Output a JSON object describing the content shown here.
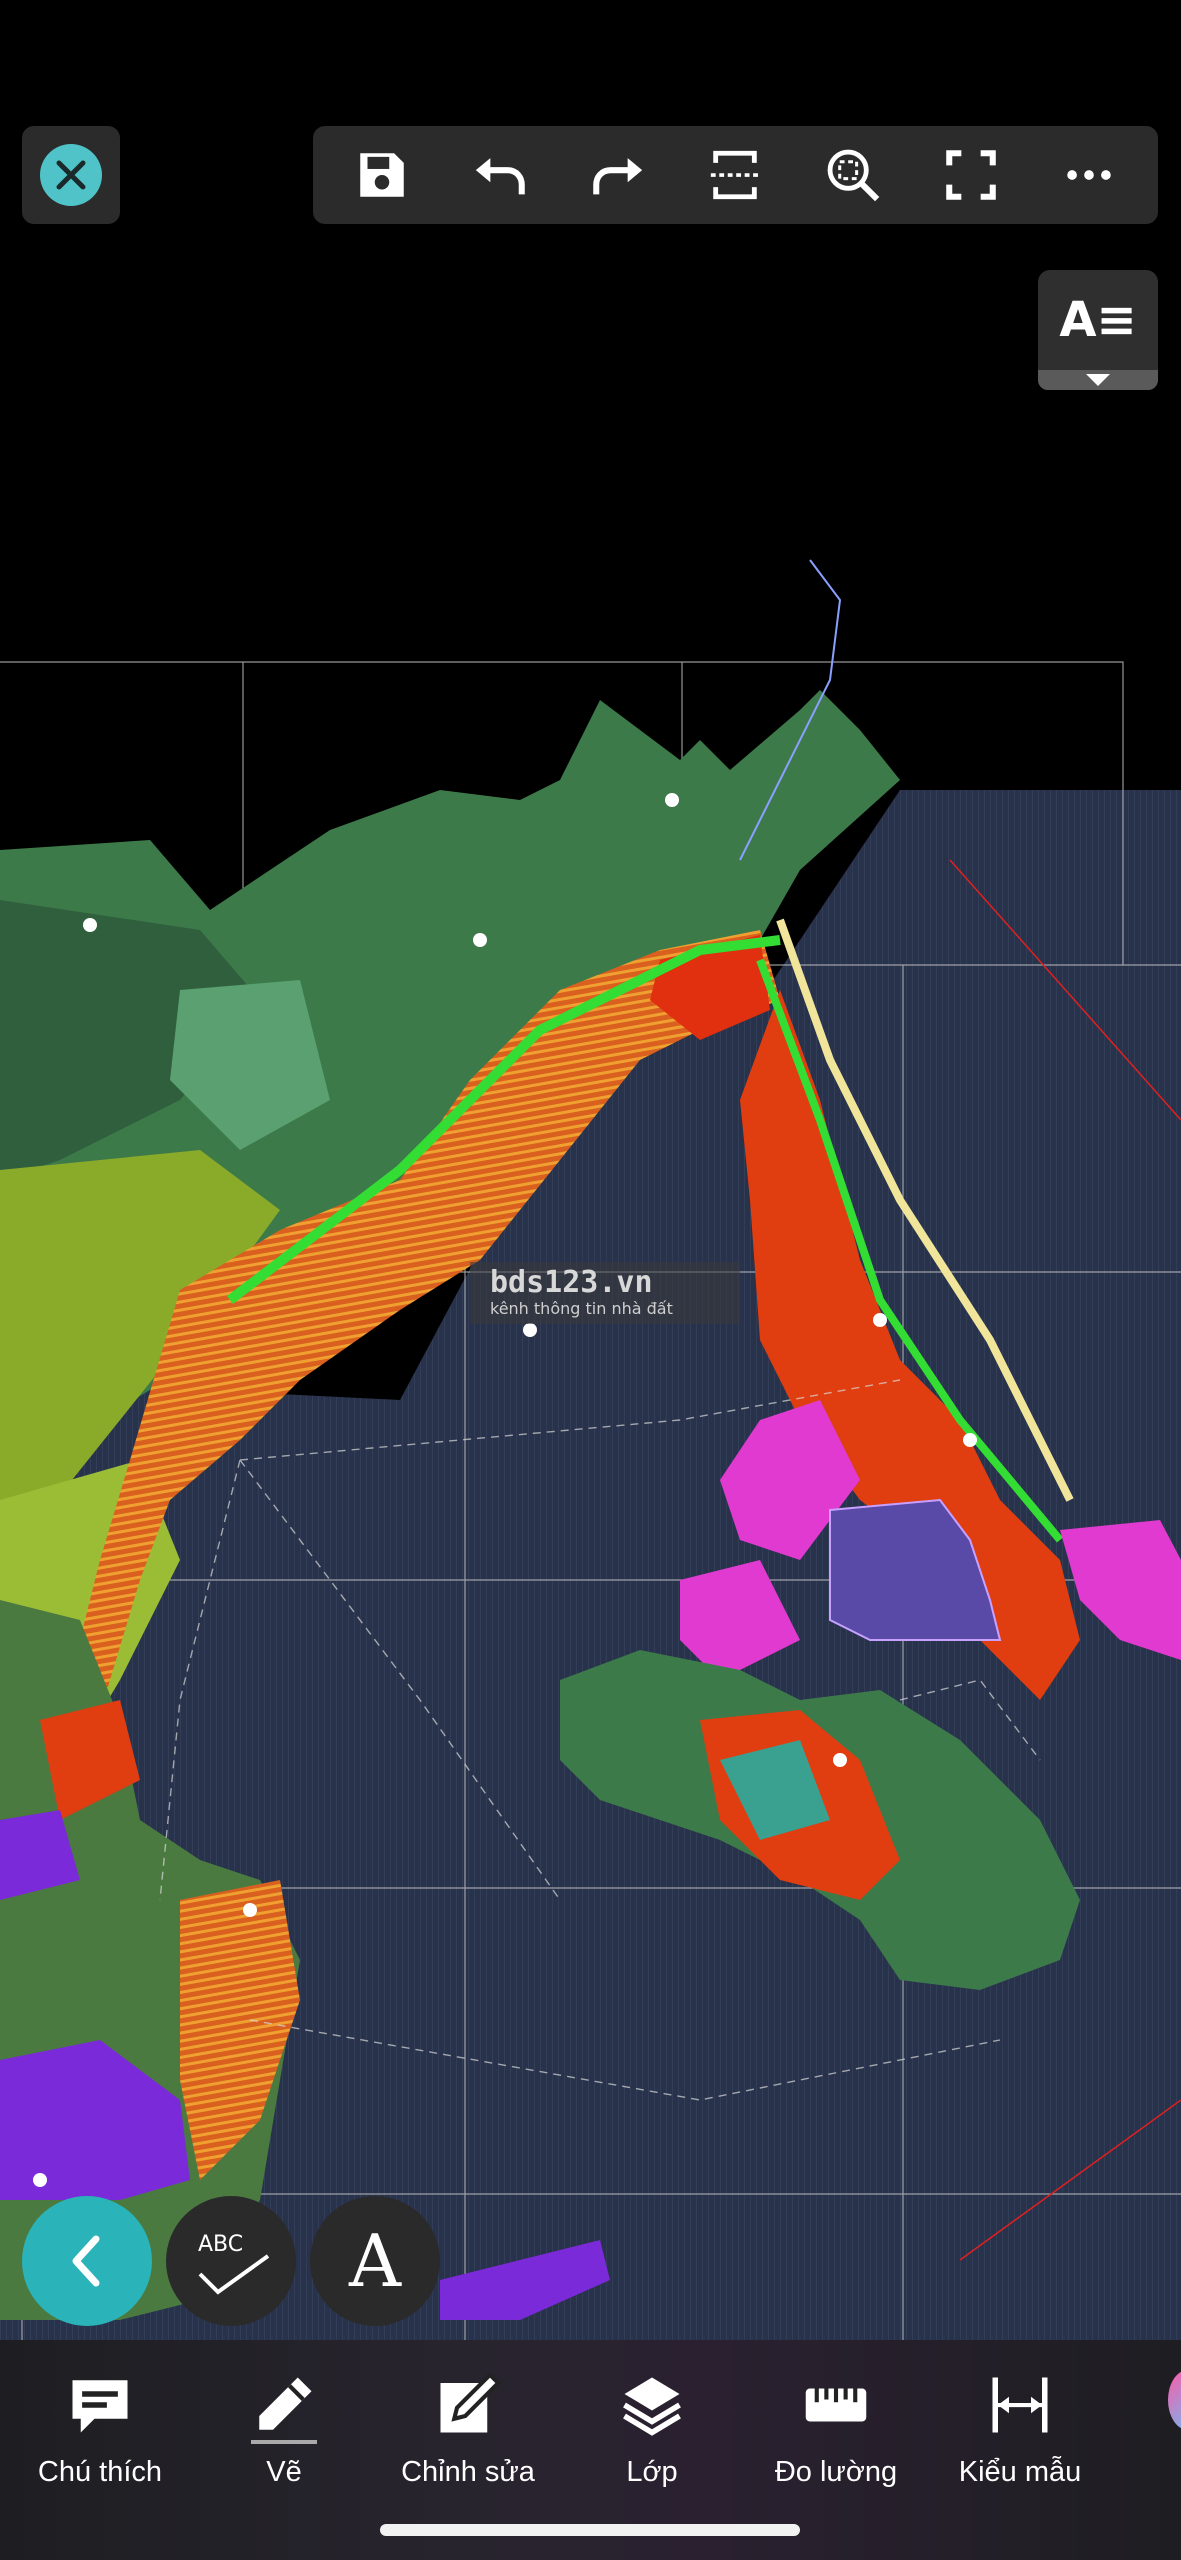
{
  "toolbar": {
    "close": "close-icon",
    "buttons": [
      "save-icon",
      "undo-icon",
      "redo-icon",
      "fit-width-icon",
      "zoom-region-icon",
      "fullscreen-icon",
      "more-icon"
    ]
  },
  "layers_button": {
    "label": "A≡"
  },
  "drawing": {
    "watermark_title": "bds123.vn",
    "watermark_subtitle": "kênh thông tin nhà đất"
  },
  "fabs": {
    "back": "chevron-left-icon",
    "spellcheck": {
      "label": "ABC"
    },
    "text": {
      "label": "A"
    }
  },
  "bottom_nav": {
    "items": [
      {
        "label": "Chú thích",
        "icon": "comment-icon"
      },
      {
        "label": "Vẽ",
        "icon": "pencil-icon"
      },
      {
        "label": "Chỉnh sửa",
        "icon": "edit-icon"
      },
      {
        "label": "Lớp",
        "icon": "layers-icon"
      },
      {
        "label": "Đo lường",
        "icon": "ruler-icon"
      },
      {
        "label": "Kiểu mẫu",
        "icon": "dimension-icon"
      }
    ]
  },
  "colors": {
    "accent": "#2ab3b8",
    "background": "#000000",
    "toolbar": "#2b2b2b"
  }
}
